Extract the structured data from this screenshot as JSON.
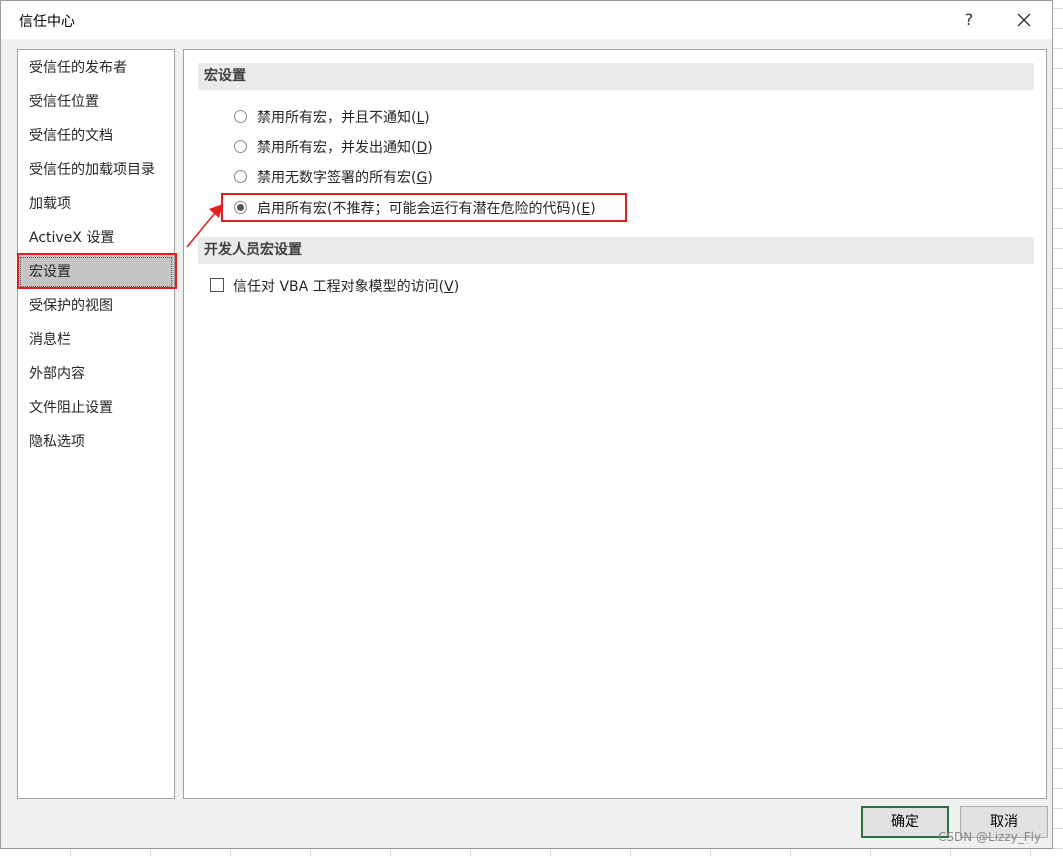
{
  "window": {
    "title": "信任中心",
    "help_label": "?"
  },
  "sidebar": {
    "items": [
      {
        "label": "受信任的发布者"
      },
      {
        "label": "受信任位置"
      },
      {
        "label": "受信任的文档"
      },
      {
        "label": "受信任的加载项目录"
      },
      {
        "label": "加载项"
      },
      {
        "label": "ActiveX 设置"
      },
      {
        "label": "宏设置",
        "selected": true
      },
      {
        "label": "受保护的视图"
      },
      {
        "label": "消息栏"
      },
      {
        "label": "外部内容"
      },
      {
        "label": "文件阻止设置"
      },
      {
        "label": "隐私选项"
      }
    ]
  },
  "macro_settings": {
    "header": "宏设置",
    "options": [
      {
        "label": "禁用所有宏，并且不通知(",
        "key": "L",
        "suffix": ")",
        "selected": false
      },
      {
        "label": "禁用所有宏，并发出通知(",
        "key": "D",
        "suffix": ")",
        "selected": false
      },
      {
        "label": "禁用无数字签署的所有宏(",
        "key": "G",
        "suffix": ")",
        "selected": false
      },
      {
        "label": "启用所有宏(不推荐；可能会运行有潜在危险的代码)(",
        "key": "E",
        "suffix": ")",
        "selected": true
      }
    ]
  },
  "developer_settings": {
    "header": "开发人员宏设置",
    "vba_label": "信任对 VBA 工程对象模型的访问(",
    "vba_key": "V",
    "vba_suffix": ")",
    "vba_checked": false
  },
  "buttons": {
    "ok": "确定",
    "cancel": "取消"
  },
  "watermark": "CSDN @Lizzy_Fly",
  "colors": {
    "highlight_red": "#e02020",
    "primary_border": "#2b6e3f"
  }
}
